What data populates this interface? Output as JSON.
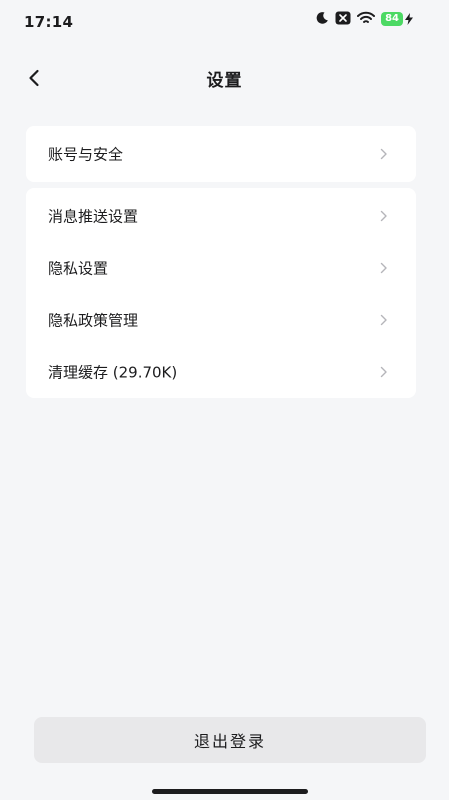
{
  "status_bar": {
    "time": "17:14",
    "battery": "84",
    "icons": [
      "moon-icon",
      "notification-muted-icon",
      "wifi-icon",
      "battery-icon",
      "charging-icon"
    ]
  },
  "nav": {
    "title": "设置",
    "back_icon": "chevron-left-icon"
  },
  "settings": {
    "group1": [
      {
        "label": "账号与安全"
      }
    ],
    "group2": [
      {
        "label": "消息推送设置"
      },
      {
        "label": "隐私设置"
      },
      {
        "label": "隐私政策管理"
      },
      {
        "label": "清理缓存 (29.70K)"
      }
    ]
  },
  "logout": {
    "label": "退出登录"
  },
  "colors": {
    "background": "#f5f6f8",
    "card": "#ffffff",
    "battery": "#4cd964",
    "button": "#e8e8ea"
  }
}
